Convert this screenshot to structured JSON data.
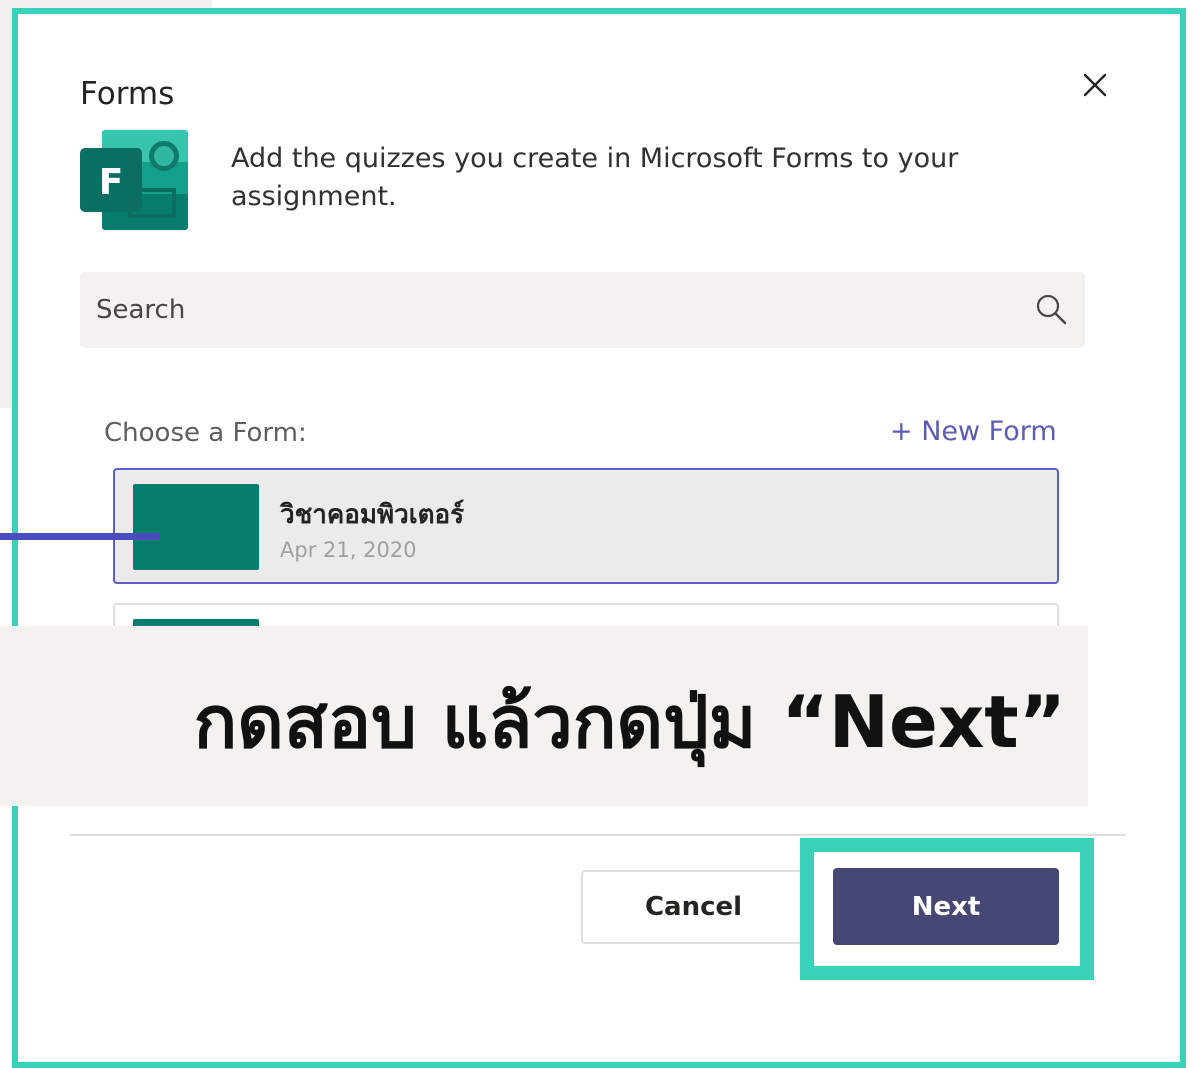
{
  "dialog": {
    "title": "Forms",
    "description": "Add the quizzes you create in Microsoft Forms to your assignment.",
    "close_icon": "close-icon",
    "logo": "microsoft-forms-logo",
    "logo_letter": "F"
  },
  "search": {
    "placeholder": "Search",
    "icon": "search-icon"
  },
  "forms_list": {
    "label": "Choose a Form:",
    "new_form_label": "+ New Form",
    "items": [
      {
        "name": "วิชาคอมพิวเตอร์",
        "date": "Apr 21, 2020",
        "selected": true
      }
    ]
  },
  "banner": {
    "text": "กดสอบ แล้วกดปุ่ม “Next”"
  },
  "footer": {
    "cancel_label": "Cancel",
    "next_label": "Next"
  },
  "colors": {
    "accent": "#3bd0b8",
    "brand": "#464775",
    "link": "#5c5db1",
    "selection_border": "#5b5fc7",
    "forms_green": "#077d6e"
  }
}
